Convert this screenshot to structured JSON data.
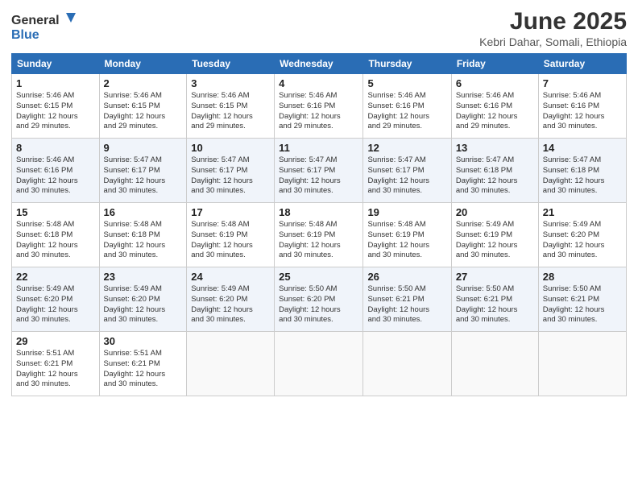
{
  "logo": {
    "general": "General",
    "blue": "Blue"
  },
  "title": "June 2025",
  "location": "Kebri Dahar, Somali, Ethiopia",
  "days_of_week": [
    "Sunday",
    "Monday",
    "Tuesday",
    "Wednesday",
    "Thursday",
    "Friday",
    "Saturday"
  ],
  "weeks": [
    [
      {
        "day": "1",
        "info": "Sunrise: 5:46 AM\nSunset: 6:15 PM\nDaylight: 12 hours\nand 29 minutes."
      },
      {
        "day": "2",
        "info": "Sunrise: 5:46 AM\nSunset: 6:15 PM\nDaylight: 12 hours\nand 29 minutes."
      },
      {
        "day": "3",
        "info": "Sunrise: 5:46 AM\nSunset: 6:15 PM\nDaylight: 12 hours\nand 29 minutes."
      },
      {
        "day": "4",
        "info": "Sunrise: 5:46 AM\nSunset: 6:16 PM\nDaylight: 12 hours\nand 29 minutes."
      },
      {
        "day": "5",
        "info": "Sunrise: 5:46 AM\nSunset: 6:16 PM\nDaylight: 12 hours\nand 29 minutes."
      },
      {
        "day": "6",
        "info": "Sunrise: 5:46 AM\nSunset: 6:16 PM\nDaylight: 12 hours\nand 29 minutes."
      },
      {
        "day": "7",
        "info": "Sunrise: 5:46 AM\nSunset: 6:16 PM\nDaylight: 12 hours\nand 30 minutes."
      }
    ],
    [
      {
        "day": "8",
        "info": "Sunrise: 5:46 AM\nSunset: 6:16 PM\nDaylight: 12 hours\nand 30 minutes."
      },
      {
        "day": "9",
        "info": "Sunrise: 5:47 AM\nSunset: 6:17 PM\nDaylight: 12 hours\nand 30 minutes."
      },
      {
        "day": "10",
        "info": "Sunrise: 5:47 AM\nSunset: 6:17 PM\nDaylight: 12 hours\nand 30 minutes."
      },
      {
        "day": "11",
        "info": "Sunrise: 5:47 AM\nSunset: 6:17 PM\nDaylight: 12 hours\nand 30 minutes."
      },
      {
        "day": "12",
        "info": "Sunrise: 5:47 AM\nSunset: 6:17 PM\nDaylight: 12 hours\nand 30 minutes."
      },
      {
        "day": "13",
        "info": "Sunrise: 5:47 AM\nSunset: 6:18 PM\nDaylight: 12 hours\nand 30 minutes."
      },
      {
        "day": "14",
        "info": "Sunrise: 5:47 AM\nSunset: 6:18 PM\nDaylight: 12 hours\nand 30 minutes."
      }
    ],
    [
      {
        "day": "15",
        "info": "Sunrise: 5:48 AM\nSunset: 6:18 PM\nDaylight: 12 hours\nand 30 minutes."
      },
      {
        "day": "16",
        "info": "Sunrise: 5:48 AM\nSunset: 6:18 PM\nDaylight: 12 hours\nand 30 minutes."
      },
      {
        "day": "17",
        "info": "Sunrise: 5:48 AM\nSunset: 6:19 PM\nDaylight: 12 hours\nand 30 minutes."
      },
      {
        "day": "18",
        "info": "Sunrise: 5:48 AM\nSunset: 6:19 PM\nDaylight: 12 hours\nand 30 minutes."
      },
      {
        "day": "19",
        "info": "Sunrise: 5:48 AM\nSunset: 6:19 PM\nDaylight: 12 hours\nand 30 minutes."
      },
      {
        "day": "20",
        "info": "Sunrise: 5:49 AM\nSunset: 6:19 PM\nDaylight: 12 hours\nand 30 minutes."
      },
      {
        "day": "21",
        "info": "Sunrise: 5:49 AM\nSunset: 6:20 PM\nDaylight: 12 hours\nand 30 minutes."
      }
    ],
    [
      {
        "day": "22",
        "info": "Sunrise: 5:49 AM\nSunset: 6:20 PM\nDaylight: 12 hours\nand 30 minutes."
      },
      {
        "day": "23",
        "info": "Sunrise: 5:49 AM\nSunset: 6:20 PM\nDaylight: 12 hours\nand 30 minutes."
      },
      {
        "day": "24",
        "info": "Sunrise: 5:49 AM\nSunset: 6:20 PM\nDaylight: 12 hours\nand 30 minutes."
      },
      {
        "day": "25",
        "info": "Sunrise: 5:50 AM\nSunset: 6:20 PM\nDaylight: 12 hours\nand 30 minutes."
      },
      {
        "day": "26",
        "info": "Sunrise: 5:50 AM\nSunset: 6:21 PM\nDaylight: 12 hours\nand 30 minutes."
      },
      {
        "day": "27",
        "info": "Sunrise: 5:50 AM\nSunset: 6:21 PM\nDaylight: 12 hours\nand 30 minutes."
      },
      {
        "day": "28",
        "info": "Sunrise: 5:50 AM\nSunset: 6:21 PM\nDaylight: 12 hours\nand 30 minutes."
      }
    ],
    [
      {
        "day": "29",
        "info": "Sunrise: 5:51 AM\nSunset: 6:21 PM\nDaylight: 12 hours\nand 30 minutes."
      },
      {
        "day": "30",
        "info": "Sunrise: 5:51 AM\nSunset: 6:21 PM\nDaylight: 12 hours\nand 30 minutes."
      },
      {
        "day": "",
        "info": ""
      },
      {
        "day": "",
        "info": ""
      },
      {
        "day": "",
        "info": ""
      },
      {
        "day": "",
        "info": ""
      },
      {
        "day": "",
        "info": ""
      }
    ]
  ]
}
